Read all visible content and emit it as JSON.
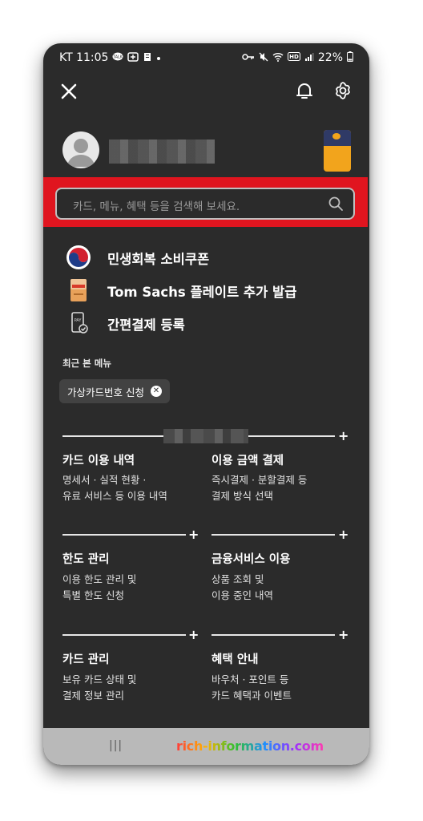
{
  "statusbar": {
    "carrier_time": "KT 11:05",
    "battery": "22%"
  },
  "search": {
    "placeholder": "카드, 메뉴, 혜택 등을 검색해 보세요."
  },
  "quick_links": [
    {
      "label": "민생회복 소비쿠폰",
      "icon": "korea-emblem-icon"
    },
    {
      "label": "Tom Sachs 플레이트 추가 발급",
      "icon": "card-plate-icon"
    },
    {
      "label": "간편결제 등록",
      "icon": "pay-phone-icon"
    }
  ],
  "recent": {
    "title": "최근 본 메뉴",
    "chip": "가상카드번호 신청"
  },
  "menus": [
    {
      "title": "카드 이용 내역",
      "desc": [
        "명세서 · 실적 현황 ·",
        "유료 서비스 등 이용 내역"
      ]
    },
    {
      "title": "이용 금액 결제",
      "desc": [
        "즉시결제 · 분할결제 등",
        "결제 방식 선택"
      ]
    },
    {
      "title": "한도 관리",
      "desc": [
        "이용 한도 관리 및",
        "특별 한도 신청"
      ]
    },
    {
      "title": "금융서비스 이용",
      "desc": [
        "상품 조회 및",
        "이용 중인 내역"
      ]
    },
    {
      "title": "카드 관리",
      "desc": [
        "보유 카드 상태 및",
        "결제 정보 관리"
      ]
    },
    {
      "title": "혜택 안내",
      "desc": [
        "바우처 · 포인트 등",
        "카드 혜택과 이벤트"
      ]
    }
  ],
  "plus_symbol": "+",
  "navbar": {
    "recents": "|||",
    "watermark": "rich-information.com"
  },
  "colors": {
    "background": "#2b2b2b",
    "highlight": "#e0151f",
    "card_accent": "#f2a41c"
  }
}
